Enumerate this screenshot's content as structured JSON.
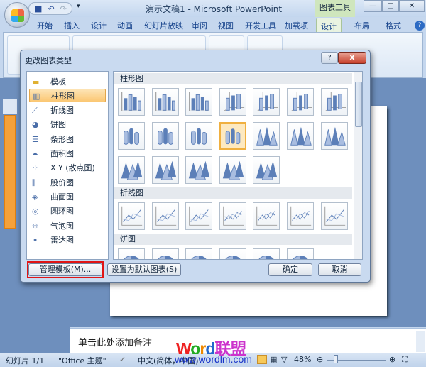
{
  "window": {
    "title": "演示文稿1 - Microsoft PowerPoint",
    "context_tab": "图表工具",
    "qat": [
      "save",
      "undo",
      "redo"
    ]
  },
  "ribbon_tabs": [
    "开始",
    "插入",
    "设计",
    "动画",
    "幻灯片放映",
    "审阅",
    "视图",
    "开发工具",
    "加载项",
    "设计",
    "布局",
    "格式"
  ],
  "dialog": {
    "title": "更改图表类型",
    "help": "?",
    "close": "X",
    "types": [
      {
        "label": "模板",
        "icon": "folder-icon"
      },
      {
        "label": "柱形图",
        "icon": "column-chart-icon",
        "selected": true
      },
      {
        "label": "折线图",
        "icon": "line-chart-icon"
      },
      {
        "label": "饼图",
        "icon": "pie-chart-icon"
      },
      {
        "label": "条形图",
        "icon": "bar-chart-icon"
      },
      {
        "label": "面积图",
        "icon": "area-chart-icon"
      },
      {
        "label": "X Y (散点图)",
        "icon": "scatter-chart-icon"
      },
      {
        "label": "股价图",
        "icon": "stock-chart-icon"
      },
      {
        "label": "曲面图",
        "icon": "surface-chart-icon"
      },
      {
        "label": "圆环图",
        "icon": "doughnut-chart-icon"
      },
      {
        "label": "气泡图",
        "icon": "bubble-chart-icon"
      },
      {
        "label": "雷达图",
        "icon": "radar-chart-icon"
      }
    ],
    "sections": [
      {
        "label": "柱形图",
        "rows": [
          [
            "col",
            "col",
            "col",
            "col3d",
            "col3d",
            "col3d",
            "col3d"
          ],
          [
            "cyl",
            "cyl",
            "cyl",
            "cyl",
            "cone",
            "cone",
            "cone"
          ],
          [
            "pyr",
            "pyr",
            "pyr",
            "pyr",
            "pyr"
          ]
        ],
        "selected": [
          1,
          3
        ]
      },
      {
        "label": "折线图",
        "rows": [
          [
            "line",
            "line",
            "line",
            "linem",
            "linem",
            "linem",
            "line3d"
          ]
        ]
      },
      {
        "label": "饼图",
        "rows": [
          [
            "pie",
            "pie",
            "pie",
            "pie",
            "pie",
            "pie"
          ]
        ]
      }
    ],
    "manage_templates": "管理模板(M)...",
    "set_default": "设置为默认图表(S)",
    "ok": "确定",
    "cancel": "取消"
  },
  "notes_placeholder": "单击此处添加备注",
  "status": {
    "slide": "幻灯片 1/1",
    "theme": "\"Office 主题\"",
    "language": "中文(简体，中国)",
    "zoom": "48%",
    "zoom_value": 48
  },
  "watermark": {
    "logo": "Word联盟",
    "url": "www.wordlm.com"
  }
}
